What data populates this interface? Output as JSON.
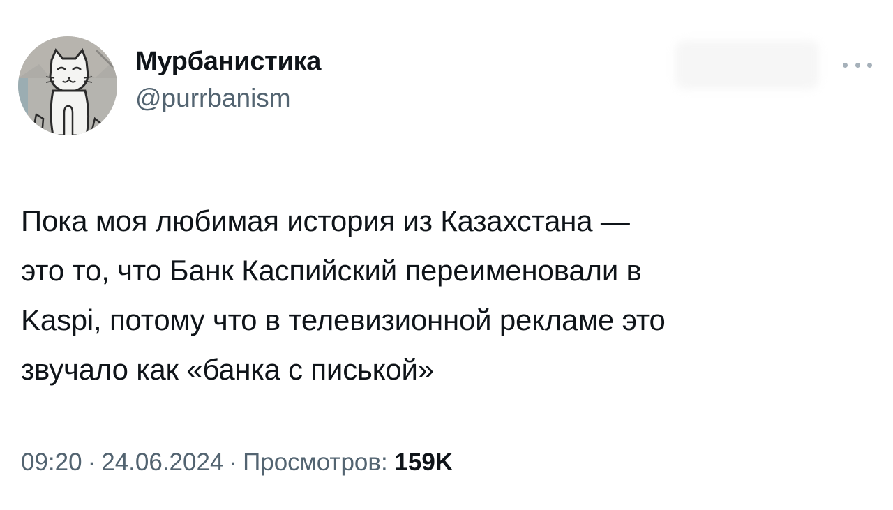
{
  "user": {
    "display_name": "Мурбанистика",
    "handle": "@purrbanism",
    "avatar": "cat-graffiti-avatar"
  },
  "tweet": {
    "text": "Пока моя любимая история из Казахстана —\nэто то, что Банк Каспийский переименовали в\nKaspi, потому что в телевизионной рекламе это\nзвучало как «банка с писькой»",
    "time": "09:20",
    "separator": "·",
    "date": "24.06.2024",
    "views_label": "Просмотров:",
    "views_count": "159K"
  },
  "icons": {
    "more": "more-dots-icon"
  }
}
